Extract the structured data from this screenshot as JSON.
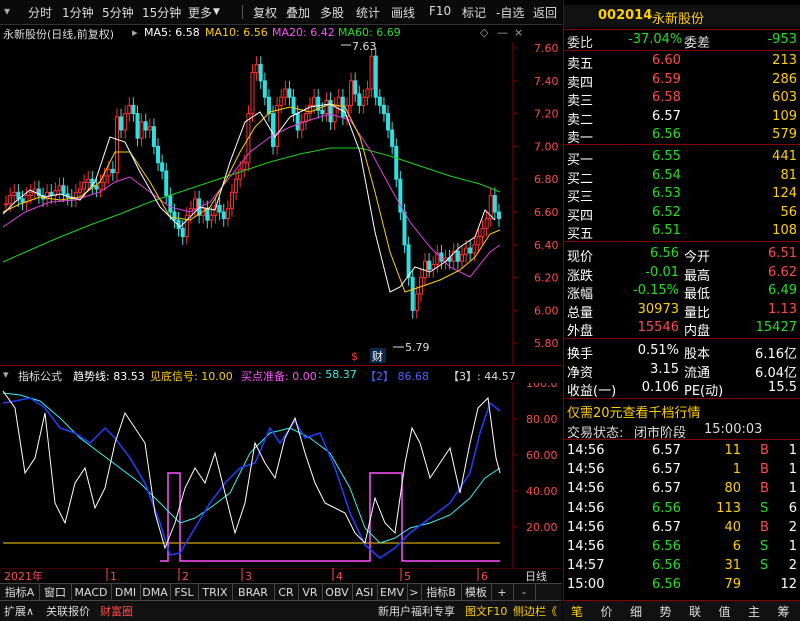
{
  "toolbar": {
    "items": [
      "分时",
      "1分钟",
      "5分钟",
      "15分钟",
      "更多",
      "复权",
      "叠加",
      "多股",
      "统计",
      "画线",
      "F10",
      "标记",
      "-自选",
      "返回"
    ]
  },
  "chart_info": {
    "title": "永新股份(日线,前复权)",
    "ma5": "MA5: 6.58",
    "ma10": "MA10: 6.56",
    "ma20": "MA20: 6.42",
    "ma60": "MA60: 6.69",
    "high_label": "7.63",
    "low_label": "5.79",
    "event_s": "$",
    "event_cai": "财"
  },
  "price_axis": [
    "7.60",
    "7.40",
    "7.20",
    "7.00",
    "6.80",
    "6.60",
    "6.40",
    "6.20",
    "6.00",
    "5.80"
  ],
  "indicator": {
    "name": "指标公式",
    "l1": "趋势线: 83.53",
    "l2": "见底信号: 10.00",
    "l3": "买点准备: 0.00",
    "l4": ": 58.37",
    "l5": "【2】 86.68",
    "l6": "【3】: 44.57",
    "axis": [
      "100.0",
      "80.00",
      "60.00",
      "40.00",
      "20.00"
    ]
  },
  "date_axis": {
    "year": "2021年",
    "months": [
      "1",
      "2",
      "3",
      "4",
      "5",
      "6"
    ],
    "period": "日线"
  },
  "tabs": [
    "指标A",
    "窗口",
    "MACD",
    "DMI",
    "DMA",
    "FSL",
    "TRIX",
    "BRAR",
    "CR",
    "VR",
    "OBV",
    "ASI",
    "EMV",
    ">",
    "指标B",
    "模板",
    "+",
    "-"
  ],
  "status": {
    "expand": "扩展∧",
    "report": "关联报价",
    "wealth": "财富圈",
    "promo": "新用户福利专享",
    "f10": "图文F10",
    "sidebar": "侧边栏《"
  },
  "quote": {
    "code": "002014",
    "name": "永新股份",
    "weibi_label": "委比",
    "weibi": "-37.04%",
    "weicha_label": "委差",
    "weicha": "-953",
    "asks": [
      {
        "label": "卖五",
        "price": "6.60",
        "vol": "213"
      },
      {
        "label": "卖四",
        "price": "6.59",
        "vol": "286"
      },
      {
        "label": "卖三",
        "price": "6.58",
        "vol": "603"
      },
      {
        "label": "卖二",
        "price": "6.57",
        "vol": "109"
      },
      {
        "label": "卖一",
        "price": "6.56",
        "vol": "579"
      }
    ],
    "bids": [
      {
        "label": "买一",
        "price": "6.55",
        "vol": "441"
      },
      {
        "label": "买二",
        "price": "6.54",
        "vol": "81"
      },
      {
        "label": "买三",
        "price": "6.53",
        "vol": "124"
      },
      {
        "label": "买四",
        "price": "6.52",
        "vol": "56"
      },
      {
        "label": "买五",
        "price": "6.51",
        "vol": "108"
      }
    ],
    "stats1": [
      {
        "l1": "现价",
        "v1": "6.56",
        "l2": "今开",
        "v2": "6.51"
      },
      {
        "l1": "涨跌",
        "v1": "-0.01",
        "l2": "最高",
        "v2": "6.62"
      },
      {
        "l1": "涨幅",
        "v1": "-0.15%",
        "l2": "最低",
        "v2": "6.49"
      },
      {
        "l1": "总量",
        "v1": "30973",
        "l2": "量比",
        "v2": "1.13"
      },
      {
        "l1": "外盘",
        "v1": "15546",
        "l2": "内盘",
        "v2": "15427"
      }
    ],
    "stats2": [
      {
        "l1": "换手",
        "v1": "0.51%",
        "l2": "股本",
        "v2": "6.16亿"
      },
      {
        "l1": "净资",
        "v1": "3.15",
        "l2": "流通",
        "v2": "6.04亿"
      },
      {
        "l1": "收益(一)",
        "v1": "0.106",
        "l2": "PE(动)",
        "v2": "15.5"
      }
    ],
    "promo": "仅需20元查看千档行情",
    "trade_state_label": "交易状态:",
    "trade_state": "闭市阶段",
    "trade_time": "15:00:03",
    "ticks": [
      {
        "t": "14:56",
        "p": "6.57",
        "v": "11",
        "d": "B",
        "n": "1"
      },
      {
        "t": "14:56",
        "p": "6.57",
        "v": "1",
        "d": "B",
        "n": "1"
      },
      {
        "t": "14:56",
        "p": "6.57",
        "v": "80",
        "d": "B",
        "n": "1"
      },
      {
        "t": "14:56",
        "p": "6.56",
        "v": "113",
        "d": "S",
        "n": "6"
      },
      {
        "t": "14:56",
        "p": "6.57",
        "v": "40",
        "d": "B",
        "n": "2"
      },
      {
        "t": "14:56",
        "p": "6.56",
        "v": "6",
        "d": "S",
        "n": "1"
      },
      {
        "t": "14:57",
        "p": "6.56",
        "v": "31",
        "d": "S",
        "n": "2"
      },
      {
        "t": "15:00",
        "p": "6.56",
        "v": "79",
        "d": "",
        "n": "12"
      }
    ],
    "nav": [
      "笔",
      "价",
      "细",
      "势",
      "联",
      "值",
      "主",
      "筹"
    ]
  }
}
